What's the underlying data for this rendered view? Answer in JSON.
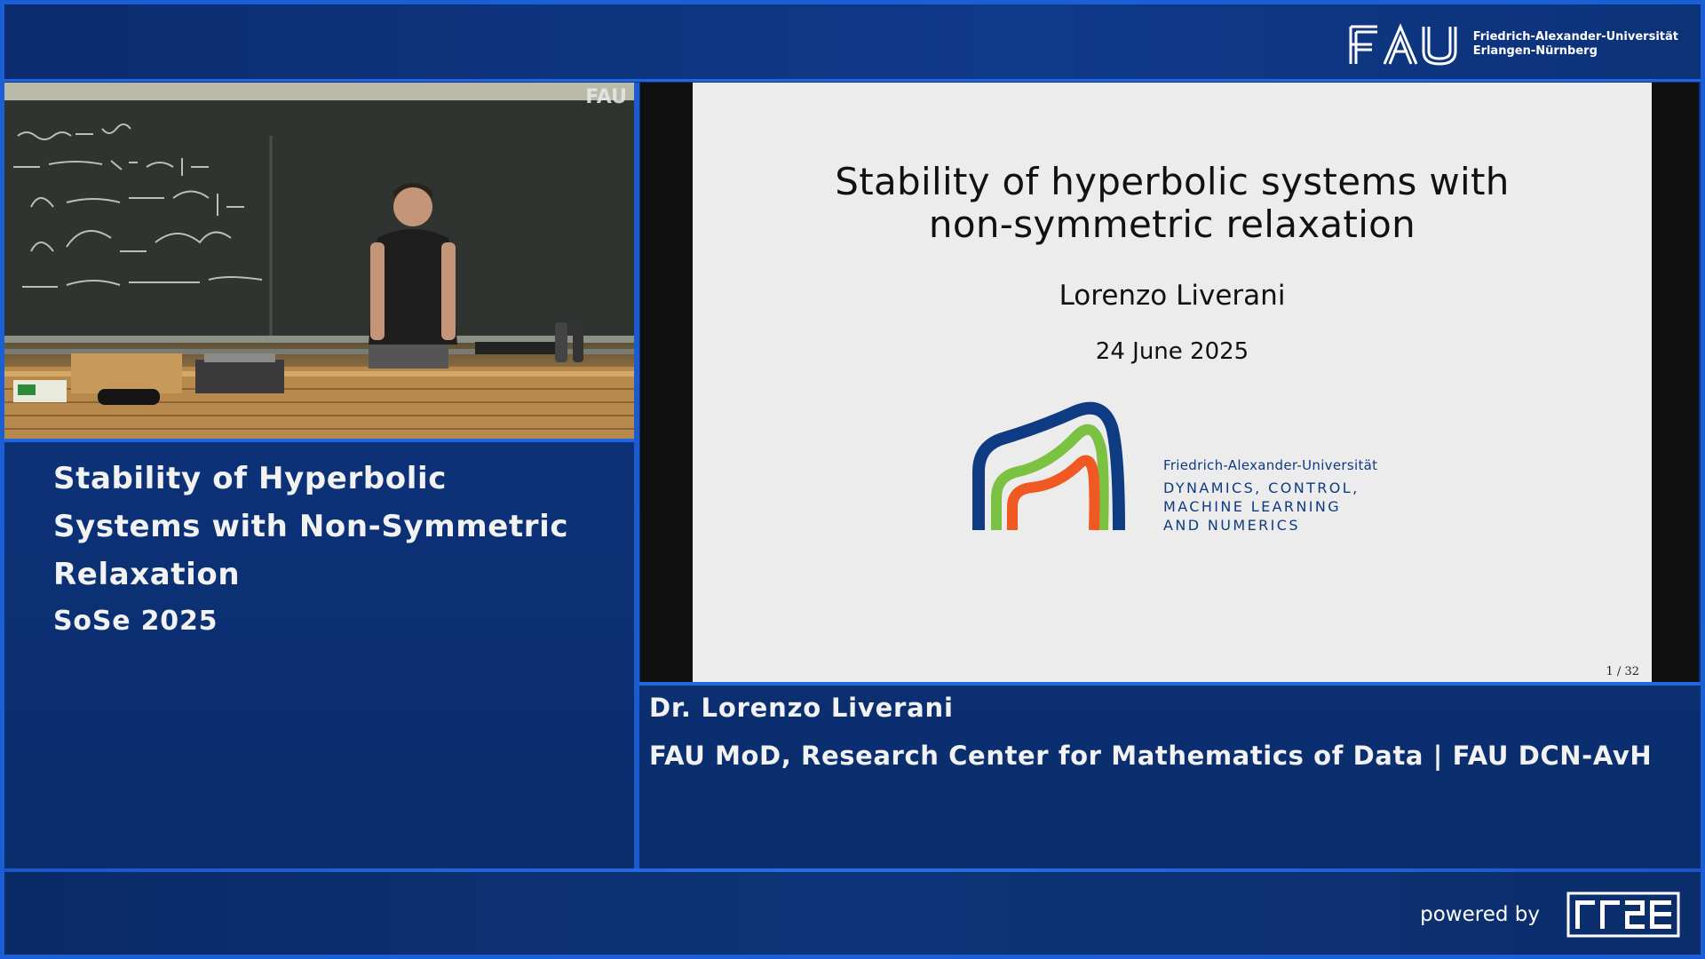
{
  "header": {
    "logo_mark": "FAU",
    "logo_line1": "Friedrich-Alexander-Universität",
    "logo_line2": "Erlangen-Nürnberg"
  },
  "camera": {
    "watermark": "FAU",
    "icon": "lecture-camera-feed"
  },
  "slide": {
    "title_line1": "Stability of hyperbolic systems with",
    "title_line2": "non-symmetric relaxation",
    "author": "Lorenzo Liverani",
    "date": "24 June 2025",
    "logo_org": "Friedrich-Alexander-Universität",
    "logo_dept_line1": "DYNAMICS, CONTROL,",
    "logo_dept_line2": "MACHINE LEARNING",
    "logo_dept_line3": "AND NUMERICS",
    "page": "1 / 32"
  },
  "lecture": {
    "title_line1": "Stability of Hyperbolic",
    "title_line2": "Systems with Non-Symmetric",
    "title_line3": "Relaxation",
    "semester": "SoSe 2025"
  },
  "speaker": {
    "name": "Dr. Lorenzo Liverani",
    "affiliation": "FAU MoD, Research Center for Mathematics of Data | FAU DCN-AvH"
  },
  "footer": {
    "powered_by": "powered by",
    "provider_logo": "RRZE"
  },
  "colors": {
    "background": "#0c3279",
    "accent": "#1f66e0",
    "slide_bg": "#ececec",
    "logo_navy": "#0f3b82",
    "logo_green": "#7cc242",
    "logo_orange": "#f05a22"
  }
}
